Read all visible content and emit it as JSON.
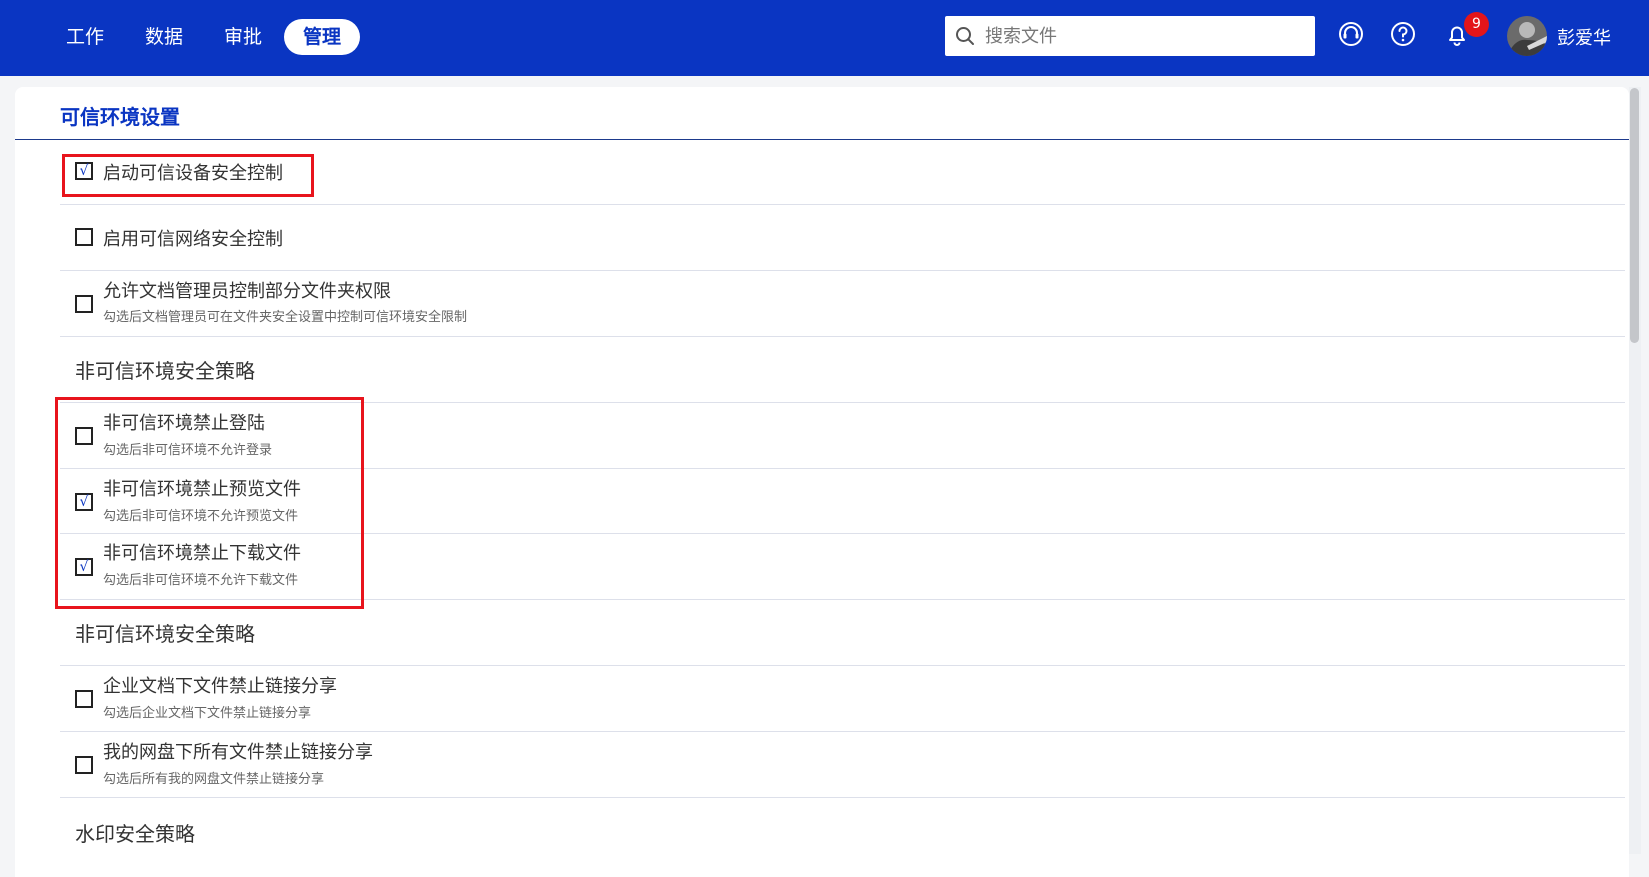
{
  "nav": {
    "items": [
      {
        "label": "工作"
      },
      {
        "label": "数据"
      },
      {
        "label": "审批"
      },
      {
        "label": "管理",
        "active": true
      }
    ]
  },
  "search": {
    "placeholder": "搜索文件",
    "value": ""
  },
  "header": {
    "icons": [
      "headset-icon",
      "help-icon",
      "bell-icon"
    ],
    "notification_count": "9",
    "username": "彭爱华"
  },
  "page": {
    "title": "可信环境设置",
    "trusted": [
      {
        "label": "启动可信设备安全控制",
        "desc": "",
        "checked": true,
        "highlighted": true
      },
      {
        "label": "启用可信网络安全控制",
        "desc": "",
        "checked": false
      },
      {
        "label": "允许文档管理员控制部分文件夹权限",
        "desc": "勾选后文档管理员可在文件夹安全设置中控制可信环境安全限制",
        "checked": false
      }
    ],
    "untrusted_section": {
      "title": "非可信环境安全策略",
      "items": [
        {
          "label": "非可信环境禁止登陆",
          "desc": "勾选后非可信环境不允许登录",
          "checked": false
        },
        {
          "label": "非可信环境禁止预览文件",
          "desc": "勾选后非可信环境不允许预览文件",
          "checked": true
        },
        {
          "label": "非可信环境禁止下载文件",
          "desc": "勾选后非可信环境不允许下载文件",
          "checked": true
        }
      ]
    },
    "share_section": {
      "title": "非可信环境安全策略",
      "items": [
        {
          "label": "企业文档下文件禁止链接分享",
          "desc": "勾选后企业文档下文件禁止链接分享",
          "checked": false
        },
        {
          "label": "我的网盘下所有文件禁止链接分享",
          "desc": "勾选后所有我的网盘文件禁止链接分享",
          "checked": false
        }
      ]
    },
    "watermark_section": {
      "title": "水印安全策略"
    }
  },
  "colors": {
    "header_bg": "#0a35c2",
    "accent": "#0a35c2",
    "highlight": "#e8141c",
    "badge": "#e3151a"
  },
  "check_glyph": "√"
}
